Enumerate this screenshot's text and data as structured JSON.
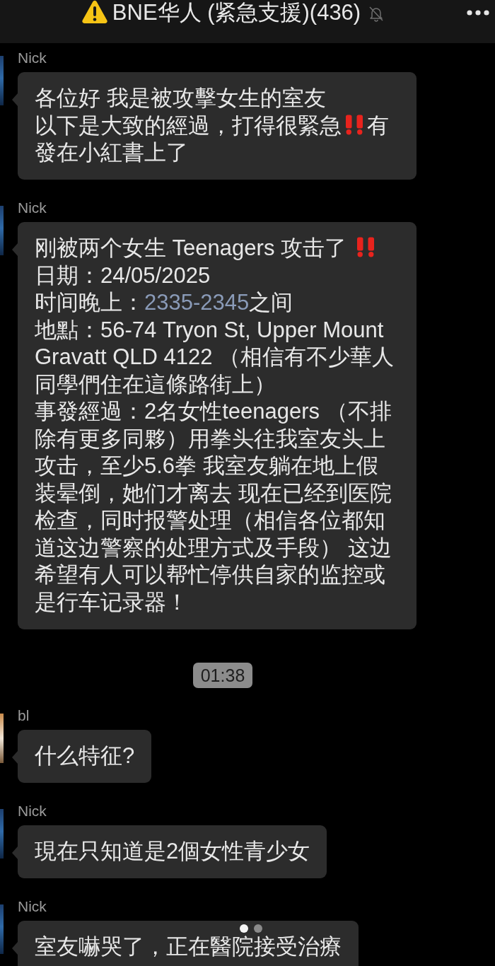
{
  "header": {
    "title": "BNE华人 (紧急支援)(436)",
    "muted": true
  },
  "timeline": [
    {
      "kind": "message",
      "sender": "Nick",
      "paragraphs": [
        {
          "parts": [
            {
              "kind": "text",
              "text": "各位好 我是被攻擊女生的室友"
            }
          ]
        },
        {
          "parts": [
            {
              "kind": "text",
              "text": "以下是大致的經過，打得很緊急"
            },
            {
              "kind": "alert"
            },
            {
              "kind": "text",
              "text": "有發在小紅書上了"
            }
          ]
        }
      ]
    },
    {
      "kind": "message",
      "sender": "Nick",
      "paragraphs": [
        {
          "parts": [
            {
              "kind": "text",
              "text": "刚被两个女生 Teenagers 攻击了 "
            },
            {
              "kind": "alert"
            }
          ]
        },
        {
          "parts": [
            {
              "kind": "text",
              "text": "日期：24/05/2025"
            }
          ]
        },
        {
          "parts": [
            {
              "kind": "text",
              "text": "时间晚上："
            },
            {
              "kind": "link",
              "text": "2335-2345"
            },
            {
              "kind": "text",
              "text": "之间"
            }
          ]
        },
        {
          "parts": [
            {
              "kind": "text",
              "text": "地點：56-74 Tryon St, Upper Mount Gravatt QLD 4122 （相信有不少華人同學們住在這條路街上）"
            }
          ]
        },
        {
          "parts": [
            {
              "kind": "text",
              "text": "事發經過：2名女性teenagers （不排除有更多同夥）用拳头往我室友头上攻击，至少5.6拳 我室友躺在地上假装晕倒，她们才离去 现在已经到医院检查，同时报警处理（相信各位都知道这边警察的处理方式及手段） 这边希望有人可以帮忙停供自家的监控或是行车记录器！"
            }
          ]
        }
      ]
    },
    {
      "kind": "time",
      "text": "01:38"
    },
    {
      "kind": "message",
      "sender": "bl",
      "paragraphs": [
        {
          "parts": [
            {
              "kind": "text",
              "text": "什么特征?"
            }
          ]
        }
      ]
    },
    {
      "kind": "message",
      "sender": "Nick",
      "paragraphs": [
        {
          "parts": [
            {
              "kind": "text",
              "text": "現在只知道是2個女性青少女"
            }
          ]
        }
      ]
    },
    {
      "kind": "message",
      "sender": "Nick",
      "paragraphs": [
        {
          "parts": [
            {
              "kind": "text",
              "text": "室友嚇哭了，正在醫院接受治療"
            }
          ]
        }
      ]
    }
  ],
  "pager": [
    {
      "selected": true
    },
    {
      "selected": false
    }
  ]
}
